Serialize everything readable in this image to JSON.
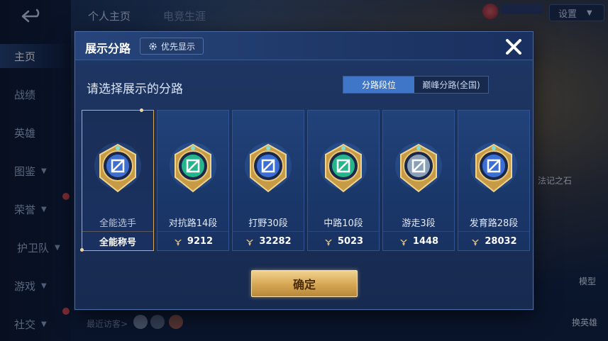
{
  "background": {
    "top_tabs": [
      "个人主页",
      "电竞生涯"
    ],
    "sidebar": [
      "主页",
      "战绩",
      "英雄",
      "图鉴",
      "荣誉",
      "护卫队",
      "游戏",
      "社交"
    ],
    "settings_label": "设置",
    "right_label_1": "法记之石",
    "right_label_2": "模型",
    "right_label_3": "换英雄",
    "visitors_label": "最近访客>"
  },
  "modal": {
    "title": "展示分路",
    "priority_label": "优先显示",
    "subtitle": "请选择展示的分路",
    "tabs": [
      {
        "label": "分路段位",
        "active": true
      },
      {
        "label": "巅峰分路(全国)",
        "active": false
      }
    ],
    "cards": [
      {
        "name": "全能选手",
        "score": "全能称号",
        "selected": true,
        "emblem": "all-round-emblem",
        "color": "#3d6fd1"
      },
      {
        "name": "对抗路14段",
        "score": "9212",
        "selected": false,
        "emblem": "clash-lane-emblem",
        "color": "#25b58a"
      },
      {
        "name": "打野30段",
        "score": "32282",
        "selected": false,
        "emblem": "jungle-emblem",
        "color": "#3b6fd6"
      },
      {
        "name": "中路10段",
        "score": "5023",
        "selected": false,
        "emblem": "mid-lane-emblem",
        "color": "#25b58a"
      },
      {
        "name": "游走3段",
        "score": "1448",
        "selected": false,
        "emblem": "roam-emblem",
        "color": "#8aa0b8"
      },
      {
        "name": "发育路28段",
        "score": "28032",
        "selected": false,
        "emblem": "farm-lane-emblem",
        "color": "#3b6fd6"
      }
    ],
    "confirm_label": "确定"
  },
  "colors": {
    "accent_gold": "#d9a95a",
    "tab_active": "#3f76c7",
    "modal_bg": "#1f3766"
  }
}
